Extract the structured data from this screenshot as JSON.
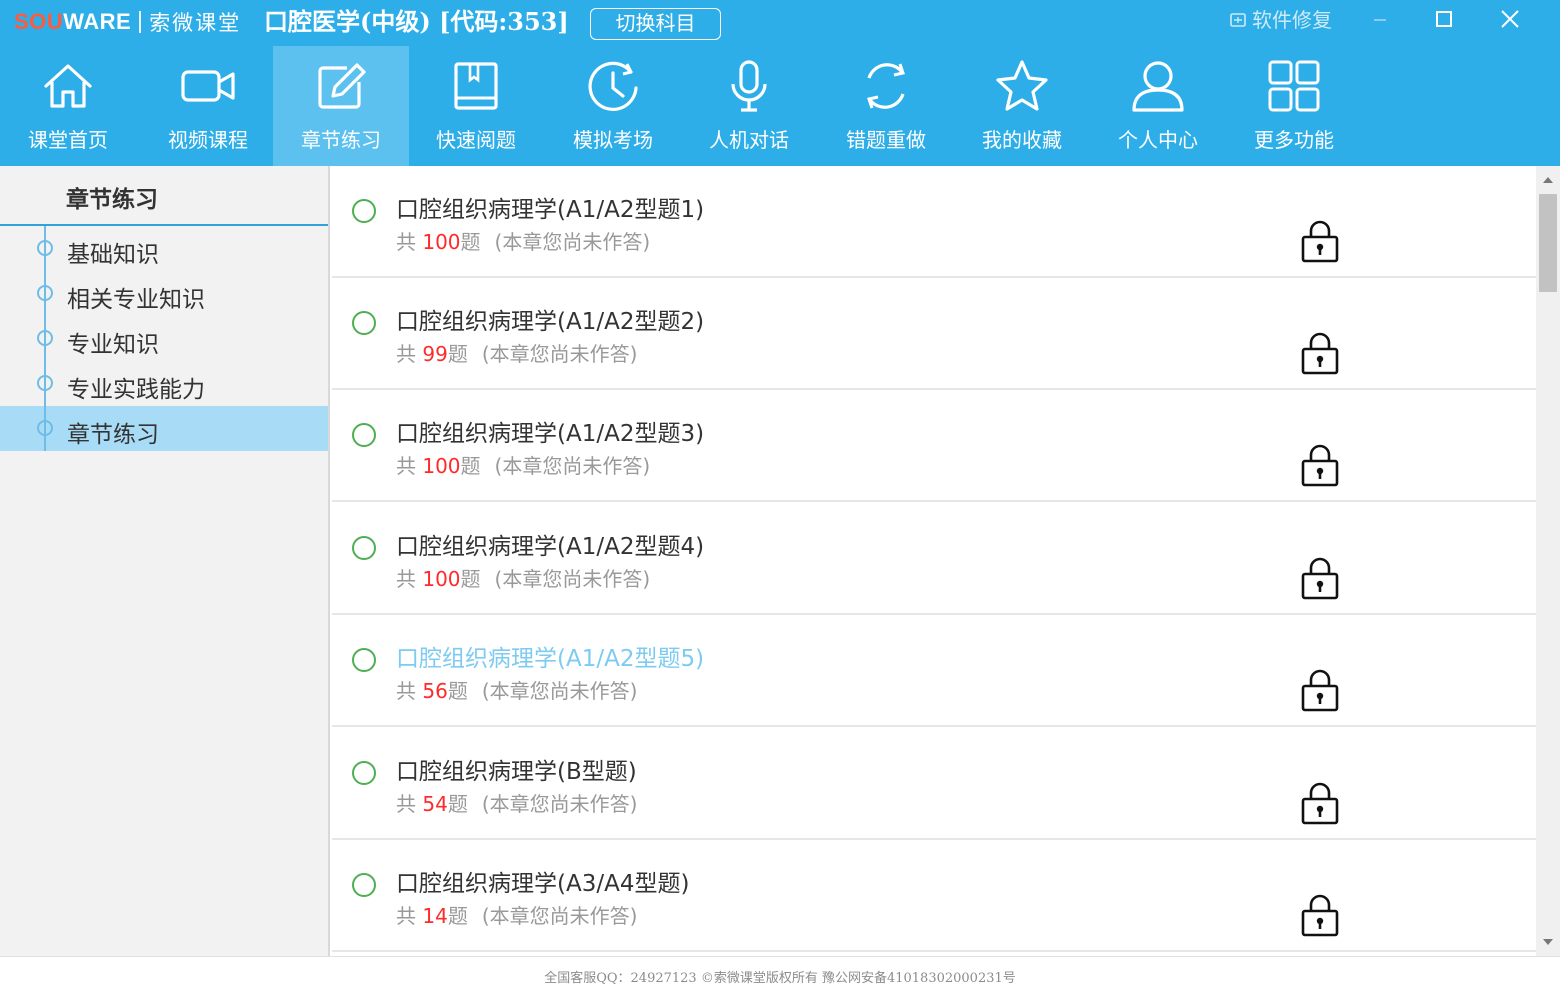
{
  "colors": {
    "header_bg": "#2eaee8",
    "nav_active_bg": "#5cc1ef",
    "sidebar_active_bg": "#a8dcf6",
    "status_green": "#4caf50",
    "count_red": "#ff2a2a",
    "hover_title": "#7ecbf2"
  },
  "titlebar": {
    "logo_sou": "SOU",
    "logo_ware": "WARE",
    "brand_cn": "索微课堂",
    "subject": "口腔医学(中级) [代码:353]",
    "switch_label": "切换科目",
    "repair_label": "软件修复",
    "window_controls": [
      "minimize-icon",
      "maximize-icon",
      "close-icon"
    ]
  },
  "nav": {
    "items": [
      {
        "label": "课堂首页",
        "icon": "home-icon"
      },
      {
        "label": "视频课程",
        "icon": "video-camera-icon"
      },
      {
        "label": "章节练习",
        "icon": "edit-icon",
        "active": true
      },
      {
        "label": "快速阅题",
        "icon": "book-icon"
      },
      {
        "label": "模拟考场",
        "icon": "clock-icon"
      },
      {
        "label": "人机对话",
        "icon": "microphone-icon"
      },
      {
        "label": "错题重做",
        "icon": "refresh-icon"
      },
      {
        "label": "我的收藏",
        "icon": "star-icon"
      },
      {
        "label": "个人中心",
        "icon": "user-icon"
      },
      {
        "label": "更多功能",
        "icon": "grid-icon"
      }
    ]
  },
  "sidebar": {
    "title": "章节练习",
    "items": [
      {
        "label": "基础知识"
      },
      {
        "label": "相关专业知识"
      },
      {
        "label": "专业知识"
      },
      {
        "label": "专业实践能力"
      },
      {
        "label": "章节练习",
        "active": true
      }
    ]
  },
  "chapters": [
    {
      "title": "口腔组织病理学(A1/A2型题1)",
      "prefix": "共 ",
      "count": "100",
      "suffix": "题",
      "note": "(本章您尚未作答)"
    },
    {
      "title": "口腔组织病理学(A1/A2型题2)",
      "prefix": "共 ",
      "count": "99",
      "suffix": "题",
      "note": "(本章您尚未作答)"
    },
    {
      "title": "口腔组织病理学(A1/A2型题3)",
      "prefix": "共 ",
      "count": "100",
      "suffix": "题",
      "note": "(本章您尚未作答)"
    },
    {
      "title": "口腔组织病理学(A1/A2型题4)",
      "prefix": "共 ",
      "count": "100",
      "suffix": "题",
      "note": "(本章您尚未作答)"
    },
    {
      "title": "口腔组织病理学(A1/A2型题5)",
      "prefix": "共 ",
      "count": "56",
      "suffix": "题",
      "note": "(本章您尚未作答)",
      "hover": true
    },
    {
      "title": "口腔组织病理学(B型题)",
      "prefix": "共 ",
      "count": "54",
      "suffix": "题",
      "note": "(本章您尚未作答)"
    },
    {
      "title": "口腔组织病理学(A3/A4型题)",
      "prefix": "共 ",
      "count": "14",
      "suffix": "题",
      "note": "(本章您尚未作答)"
    }
  ],
  "footer": {
    "text": "全国客服QQ：24927123 ©索微课堂版权所有 豫公网安备41018302000231号"
  }
}
